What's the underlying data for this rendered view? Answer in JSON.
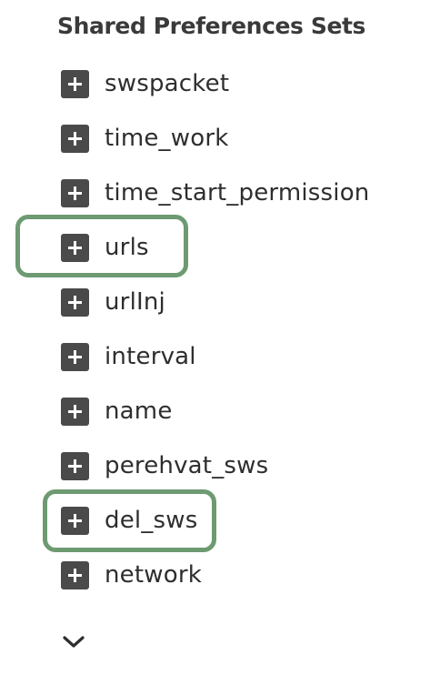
{
  "header": {
    "title": "Shared Preferences Sets"
  },
  "items": [
    {
      "label": "swspacket",
      "icon": "plus-icon",
      "highlighted": false
    },
    {
      "label": "time_work",
      "icon": "plus-icon",
      "highlighted": false
    },
    {
      "label": "time_start_permission",
      "icon": "plus-icon",
      "highlighted": false
    },
    {
      "label": "urls",
      "icon": "plus-icon",
      "highlighted": true
    },
    {
      "label": "urlInj",
      "icon": "plus-icon",
      "highlighted": false
    },
    {
      "label": "interval",
      "icon": "plus-icon",
      "highlighted": false
    },
    {
      "label": "name",
      "icon": "plus-icon",
      "highlighted": false
    },
    {
      "label": "perehvat_sws",
      "icon": "plus-icon",
      "highlighted": false
    },
    {
      "label": "del_sws",
      "icon": "plus-icon",
      "highlighted": true
    },
    {
      "label": "network",
      "icon": "plus-icon",
      "highlighted": false
    }
  ],
  "footer": {
    "expand_icon": "chevron-down-icon"
  },
  "colors": {
    "highlight_border": "#6e9a72",
    "icon_fill": "#4a4a4a",
    "text": "#2e2e2e"
  }
}
